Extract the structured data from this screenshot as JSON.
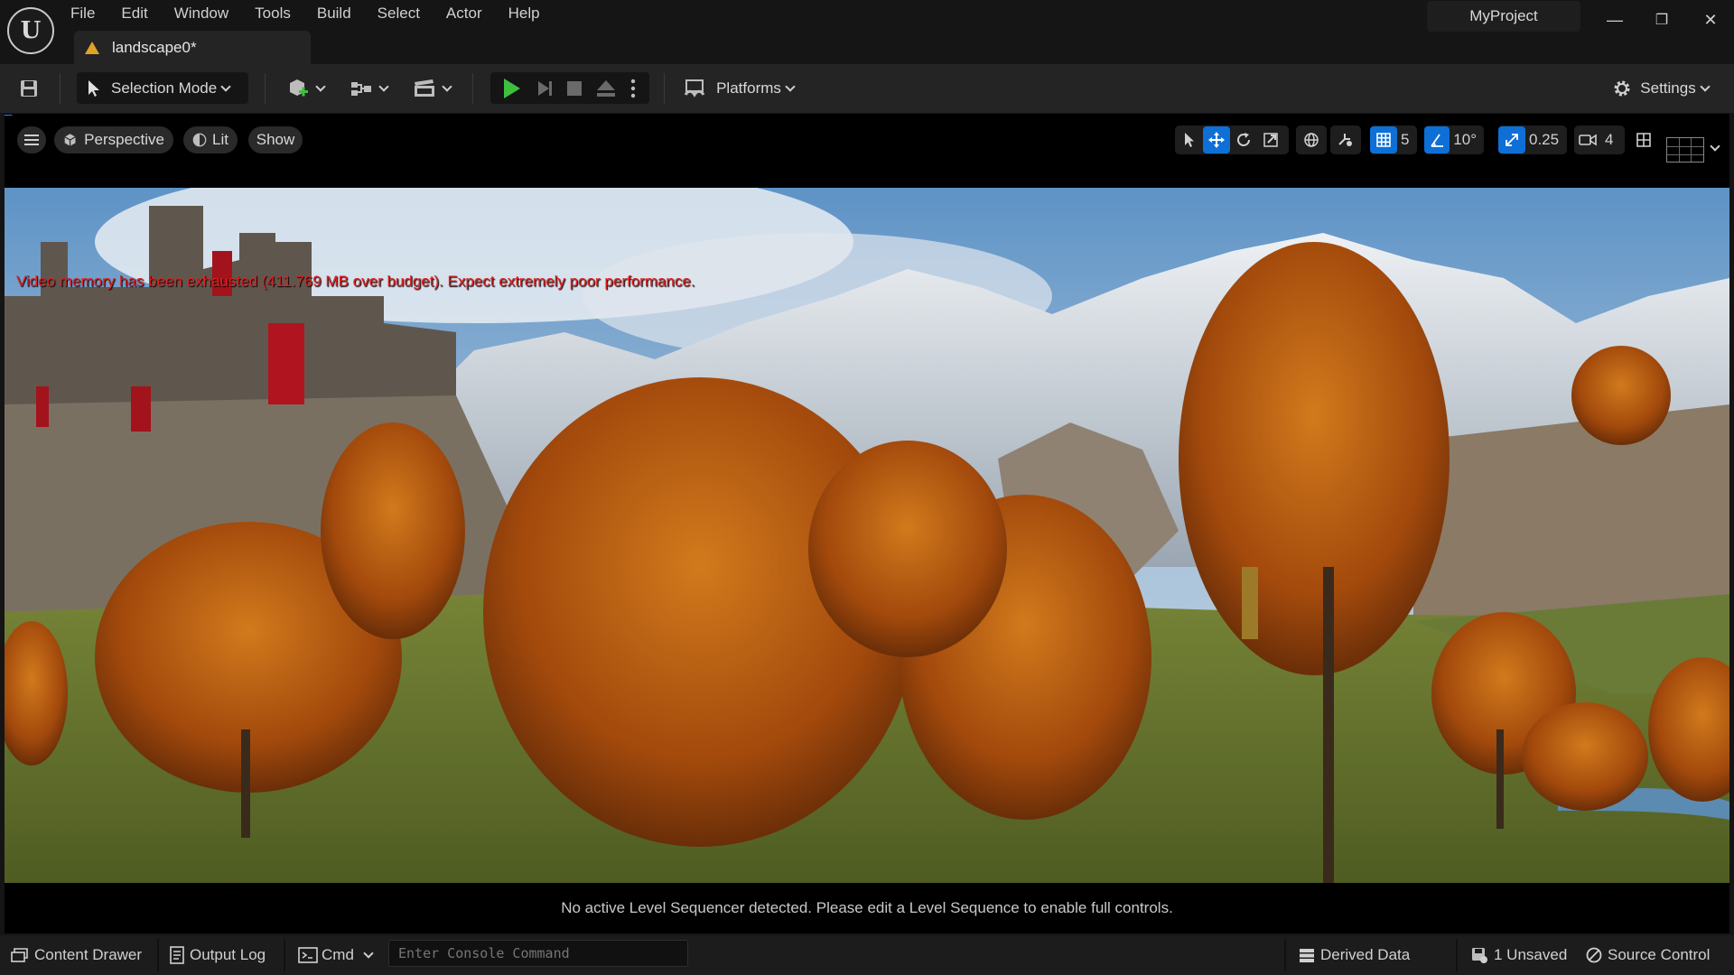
{
  "app": {
    "logo_text": "U",
    "menu": [
      "File",
      "Edit",
      "Window",
      "Tools",
      "Build",
      "Select",
      "Actor",
      "Help"
    ],
    "tab_title": "landscape0*",
    "project_name": "MyProject",
    "window_controls": {
      "minimize": "—",
      "restore": "❐",
      "close": "✕"
    }
  },
  "toolbar": {
    "selection_mode_label": "Selection Mode",
    "platforms_label": "Platforms",
    "settings_label": "Settings",
    "icons": [
      "save-icon",
      "add-actor-icon",
      "blueprint-icon",
      "cinematics-icon",
      "play-icon",
      "step-icon",
      "stop-icon",
      "eject-icon",
      "more-icon",
      "platforms-icon",
      "gear-icon"
    ],
    "play_color": "#3fbf3f"
  },
  "viewport": {
    "perspective_label": "Perspective",
    "lit_label": "Lit",
    "show_label": "Show",
    "grid_snap_value": "5",
    "rotation_snap_value": "10°",
    "scale_snap_value": "0.25",
    "camera_speed_value": "4",
    "warning_text": "Video memory has been exhausted (411.769 MB over budget). Expect extremely poor performance.",
    "sequencer_message": "No active Level Sequencer detected. Please edit a Level Sequence to enable full controls.",
    "accent_color": "#0e6fd6",
    "warning_color": "#e02020"
  },
  "statusbar": {
    "content_drawer_label": "Content Drawer",
    "output_log_label": "Output Log",
    "cmd_label": "Cmd",
    "console_placeholder": "Enter Console Command",
    "derived_data_label": "Derived Data",
    "unsaved_label": "1 Unsaved",
    "source_control_label": "Source Control"
  }
}
